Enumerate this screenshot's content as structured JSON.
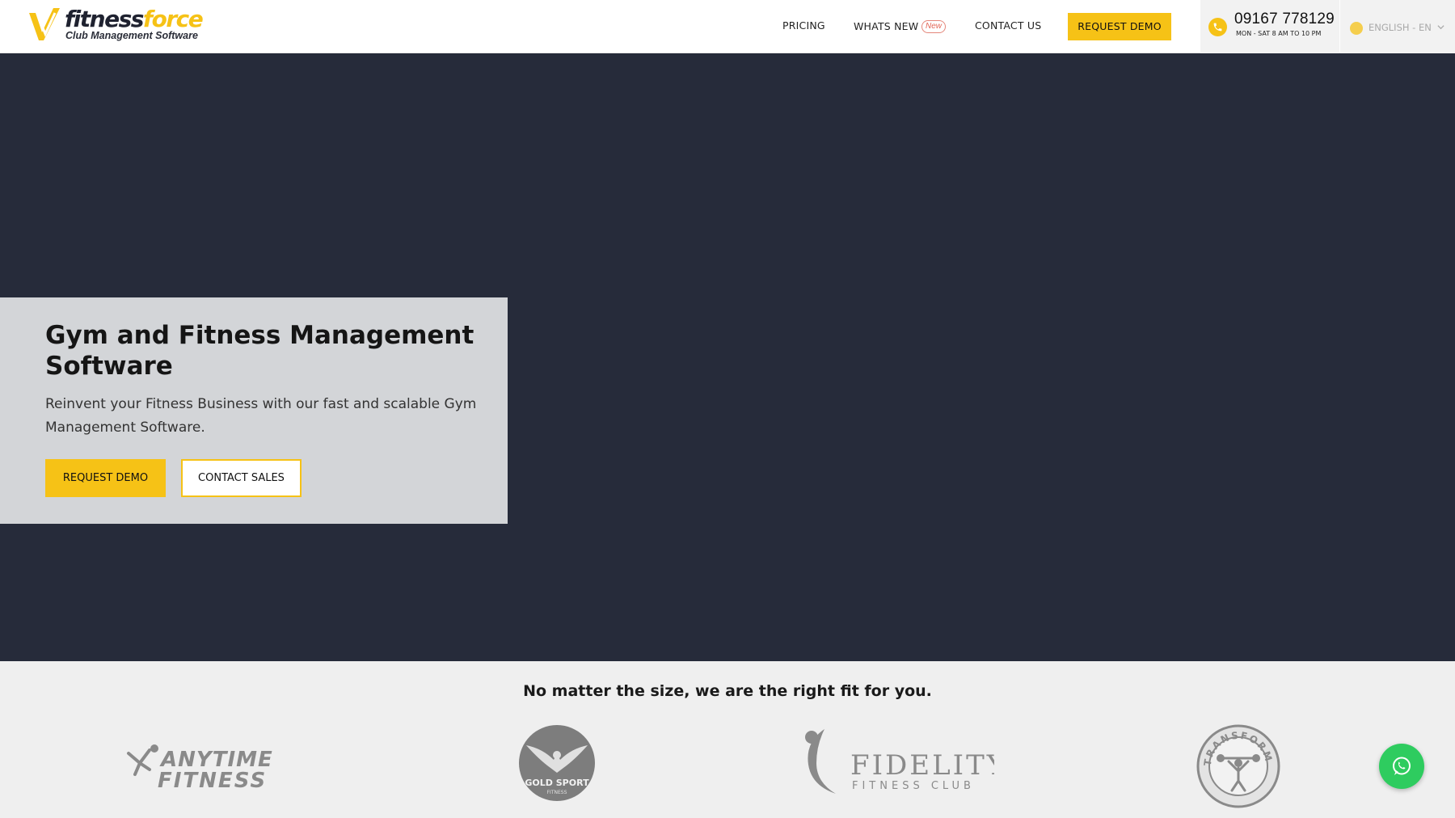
{
  "header": {
    "logo": {
      "brand_part1": "fitness",
      "brand_part2": "force",
      "tagline": "Club Management Software"
    },
    "nav": {
      "pricing": "PRICING",
      "whats_new": "WHATS NEW",
      "new_badge": "New",
      "contact_us": "CONTACT US",
      "request_demo": "REQUEST DEMO"
    },
    "phone": {
      "icon": "phone-icon",
      "number": "09167 778129",
      "hours": "MON - SAT 8 AM TO 10 PM"
    },
    "language": {
      "icon": "globe-icon",
      "label": "ENGLISH - EN"
    }
  },
  "hero": {
    "title": "Gym and Fitness Management Software",
    "subtitle": "Reinvent your Fitness Business with our fast and scalable Gym Management Software.",
    "primary_button": "REQUEST DEMO",
    "secondary_button": "CONTACT SALES"
  },
  "clients": {
    "heading": "No matter the size, we are the right fit for you.",
    "logos": [
      {
        "name": "ANYTIME FITNESS",
        "line1": "ANYTIME",
        "line2": "FITNESS"
      },
      {
        "name": "GOLD SPORT FITNESS",
        "line1": "GOLD SPORT",
        "line2": "FITNESS"
      },
      {
        "name": "FIDELITY FITNESS CLUB",
        "line1": "FIDELITY",
        "line2": "FITNESS CLUB"
      },
      {
        "name": "TRANSFORM",
        "line1": "TRANSFORM",
        "line2": ""
      }
    ]
  },
  "floating": {
    "whatsapp_icon": "whatsapp-icon"
  },
  "colors": {
    "accent": "#f6c216",
    "hero_bg": "#262b3a",
    "hero_card": "#d3d5d8",
    "clients_bg": "#efefef",
    "whatsapp": "#2ecc5f",
    "new_badge": "#e26556"
  }
}
